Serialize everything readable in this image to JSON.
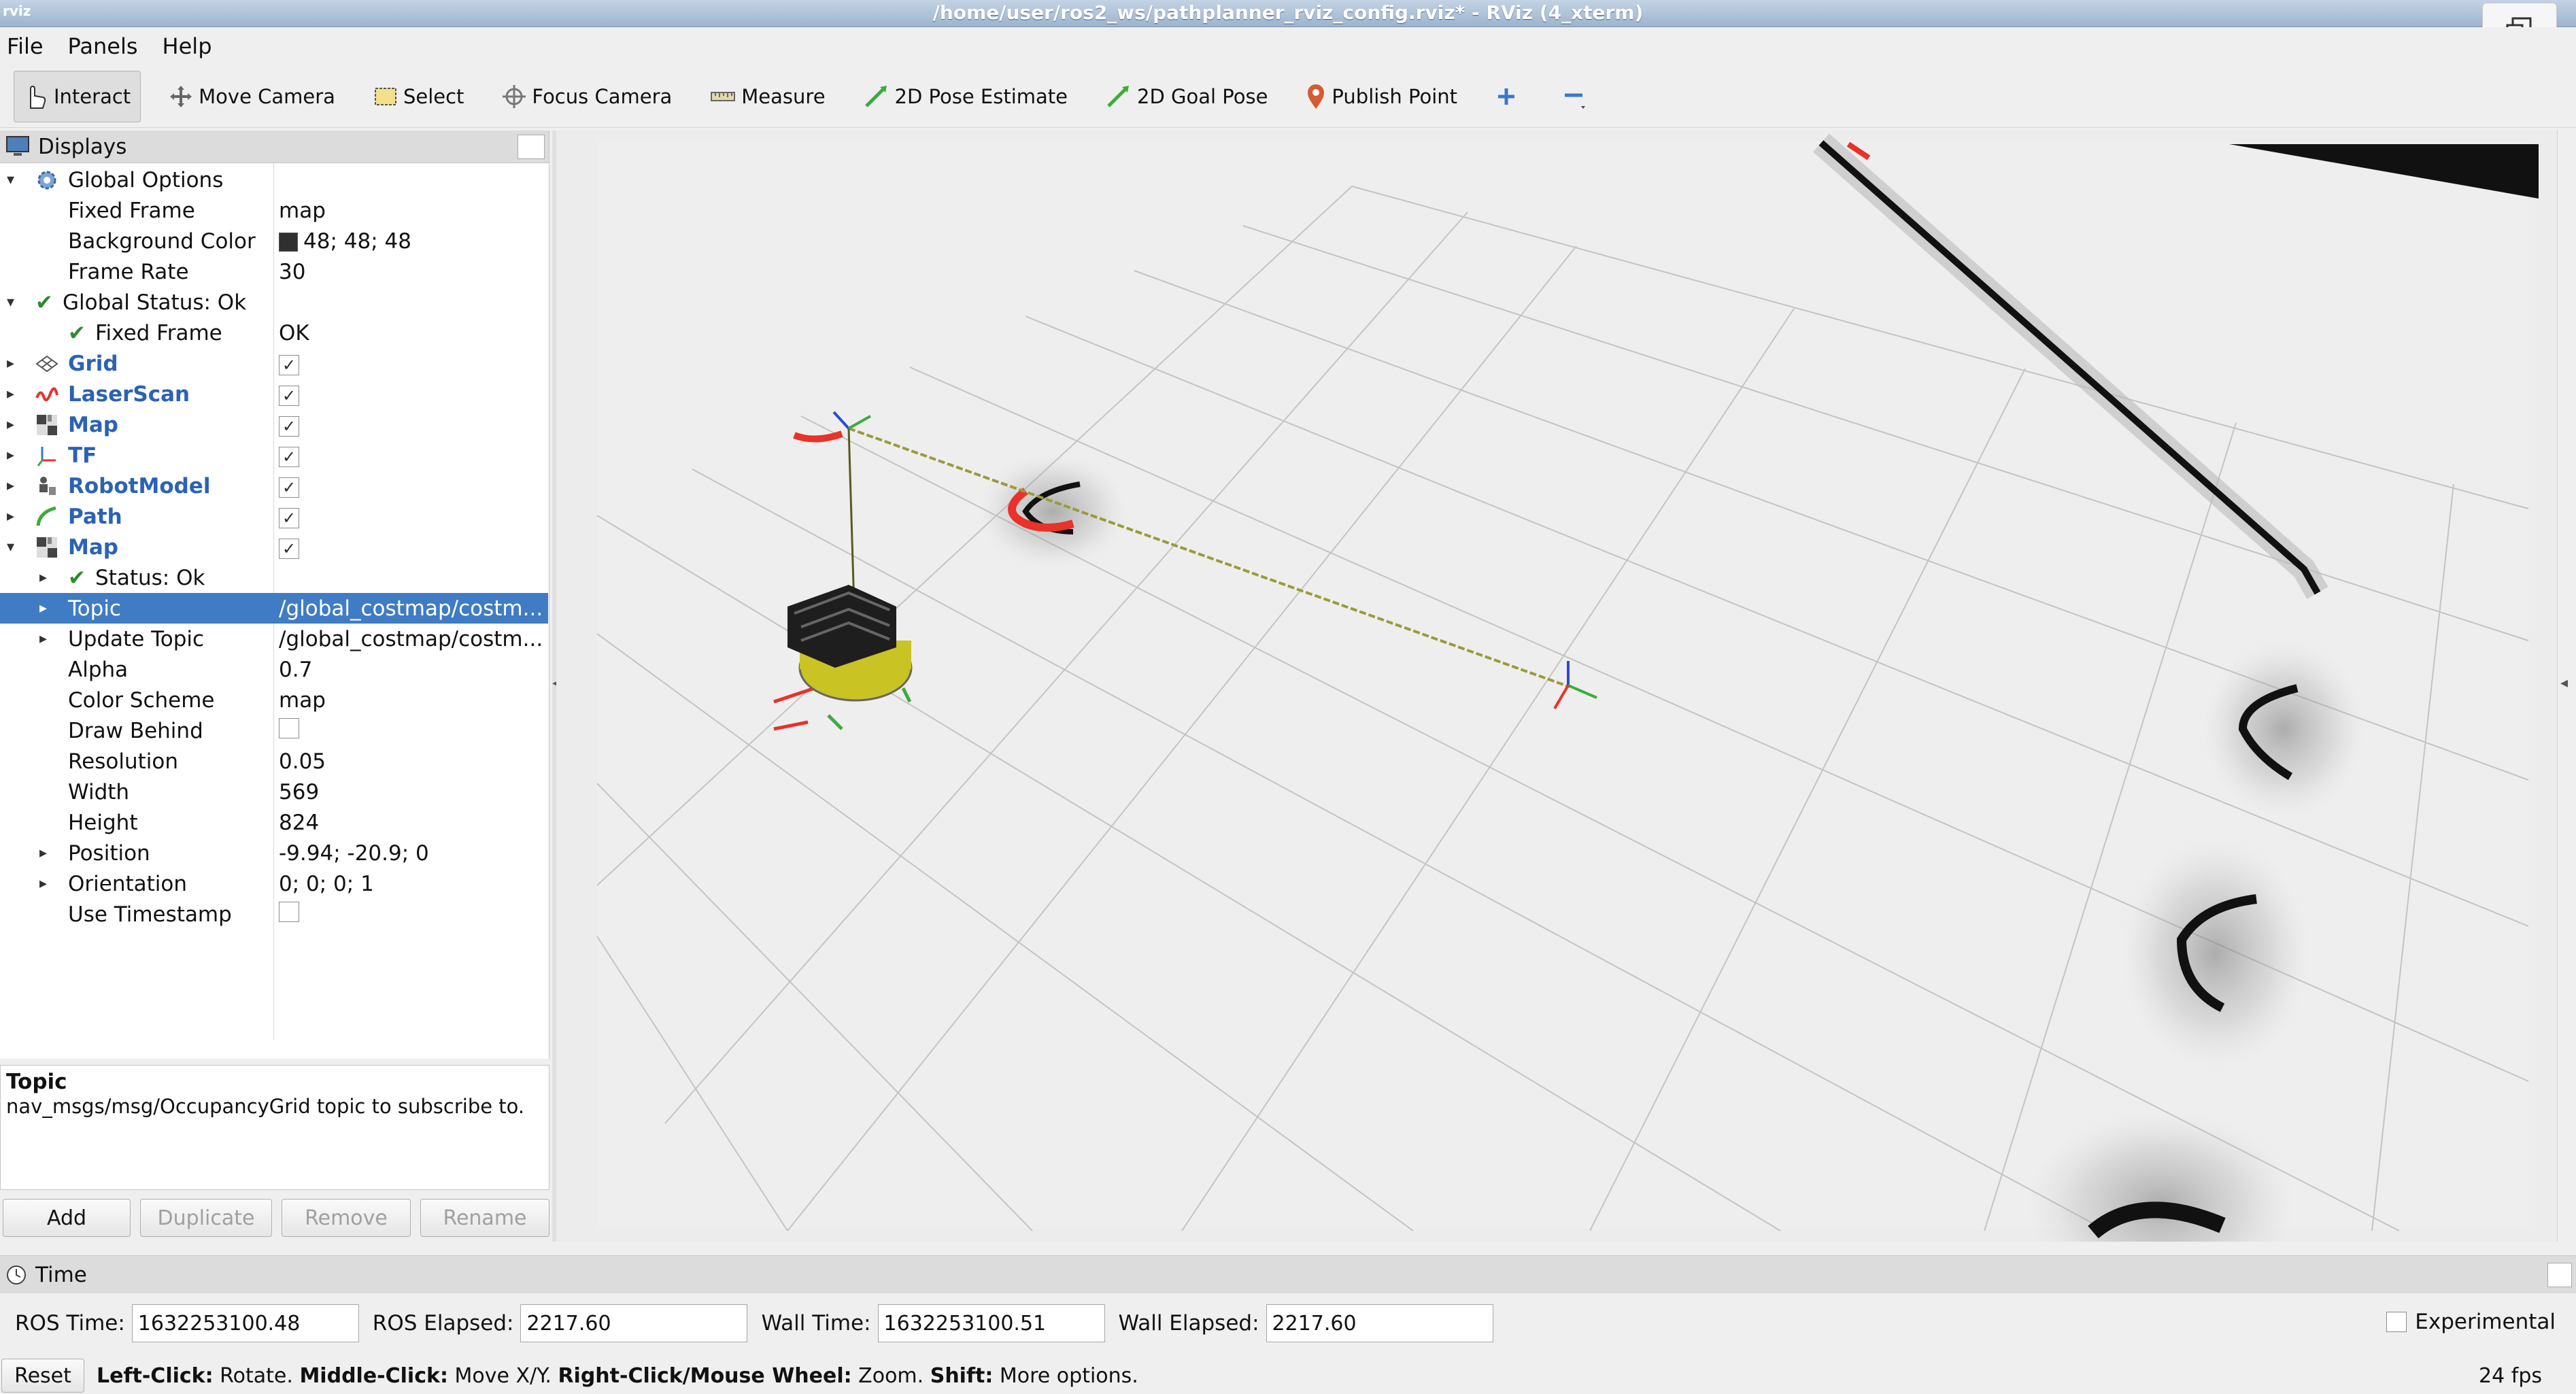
{
  "window": {
    "title": "/home/user/ros2_ws/pathplanner_rviz_config.rviz* - RViz (4_xterm)"
  },
  "menu": [
    {
      "label": "File",
      "key": "F",
      "rest": "ile"
    },
    {
      "label": "Panels",
      "key": "P",
      "rest": "anels"
    },
    {
      "label": "Help",
      "key": "H",
      "rest": "elp"
    }
  ],
  "toolbar": {
    "interact": "Interact",
    "move_camera": "Move Camera",
    "select": "Select",
    "focus_camera": "Focus Camera",
    "measure": "Measure",
    "pose_estimate": "2D Pose Estimate",
    "goal_pose": "2D Goal Pose",
    "publish_point": "Publish Point"
  },
  "displays": {
    "title": "Displays",
    "rows": [
      {
        "name": "Global Options",
        "value": ""
      },
      {
        "name": "Fixed Frame",
        "value": "map"
      },
      {
        "name": "Background Color",
        "value": "48; 48; 48"
      },
      {
        "name": "Frame Rate",
        "value": "30"
      },
      {
        "name": "Global Status: Ok",
        "value": ""
      },
      {
        "name": "Fixed Frame",
        "value": "OK"
      },
      {
        "name": "Grid",
        "value": ""
      },
      {
        "name": "LaserScan",
        "value": ""
      },
      {
        "name": "Map",
        "value": ""
      },
      {
        "name": "TF",
        "value": ""
      },
      {
        "name": "RobotModel",
        "value": ""
      },
      {
        "name": "Path",
        "value": ""
      },
      {
        "name": "Map",
        "value": ""
      },
      {
        "name": "Status: Ok",
        "value": ""
      },
      {
        "name": "Topic",
        "value": "/global_costmap/costm..."
      },
      {
        "name": "Update Topic",
        "value": "/global_costmap/costm..."
      },
      {
        "name": "Alpha",
        "value": "0.7"
      },
      {
        "name": "Color Scheme",
        "value": "map"
      },
      {
        "name": "Draw Behind",
        "value": ""
      },
      {
        "name": "Resolution",
        "value": "0.05"
      },
      {
        "name": "Width",
        "value": "569"
      },
      {
        "name": "Height",
        "value": "824"
      },
      {
        "name": "Position",
        "value": "-9.94; -20.9; 0"
      },
      {
        "name": "Orientation",
        "value": "0; 0; 0; 1"
      },
      {
        "name": "Use Timestamp",
        "value": ""
      }
    ],
    "checked": [
      true,
      true,
      true,
      true,
      true,
      true,
      true,
      false,
      false
    ]
  },
  "description": {
    "title": "Topic",
    "body": "nav_msgs/msg/OccupancyGrid topic to subscribe to."
  },
  "display_buttons": {
    "add": "Add",
    "duplicate": "Duplicate",
    "remove": "Remove",
    "rename": "Rename"
  },
  "time": {
    "title": "Time",
    "ros_time_label": "ROS Time:",
    "ros_time": "1632253100.48",
    "ros_elapsed_label": "ROS Elapsed:",
    "ros_elapsed": "2217.60",
    "wall_time_label": "Wall Time:",
    "wall_time": "1632253100.51",
    "wall_elapsed_label": "Wall Elapsed:",
    "wall_elapsed": "2217.60",
    "experimental": "Experimental"
  },
  "status": {
    "reset": "Reset",
    "left_click": "Left-Click:",
    "left_click_desc": " Rotate. ",
    "middle_click": "Middle-Click:",
    "middle_click_desc": " Move X/Y. ",
    "right_click": "Right-Click/Mouse Wheel:",
    "right_click_desc": " Zoom. ",
    "shift": "Shift:",
    "shift_desc": " More options.",
    "fps": "24 fps"
  },
  "colors": {
    "accent": "#3f7cc4",
    "display_name": "#2b62b4",
    "ok_green": "#2e8a2e",
    "laser_red": "#e8322a"
  },
  "icons": [
    "interact-icon",
    "move-camera-icon",
    "select-icon",
    "focus-camera-icon",
    "measure-icon",
    "pose-estimate-icon",
    "goal-pose-icon",
    "publish-point-icon",
    "add-tool-icon",
    "remove-tool-icon"
  ]
}
